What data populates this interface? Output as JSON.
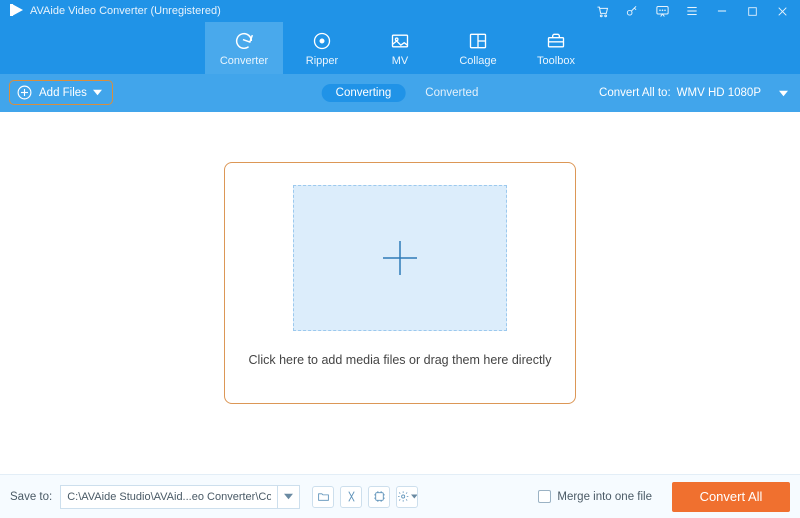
{
  "title": "AVAide Video Converter  (Unregistered)",
  "nav": {
    "converter": "Converter",
    "ripper": "Ripper",
    "mv": "MV",
    "collage": "Collage",
    "toolbox": "Toolbox"
  },
  "subnav": {
    "add_files": "Add Files",
    "converting": "Converting",
    "converted": "Converted",
    "convert_all_to": "Convert All to:",
    "format": "WMV HD 1080P"
  },
  "dropzone": {
    "text": "Click here to add media files or drag them here directly"
  },
  "footer": {
    "save_to_label": "Save to:",
    "save_path": "C:\\AVAide Studio\\AVAid...eo Converter\\Converted",
    "merge_label": "Merge into one file",
    "convert_btn": "Convert All"
  }
}
